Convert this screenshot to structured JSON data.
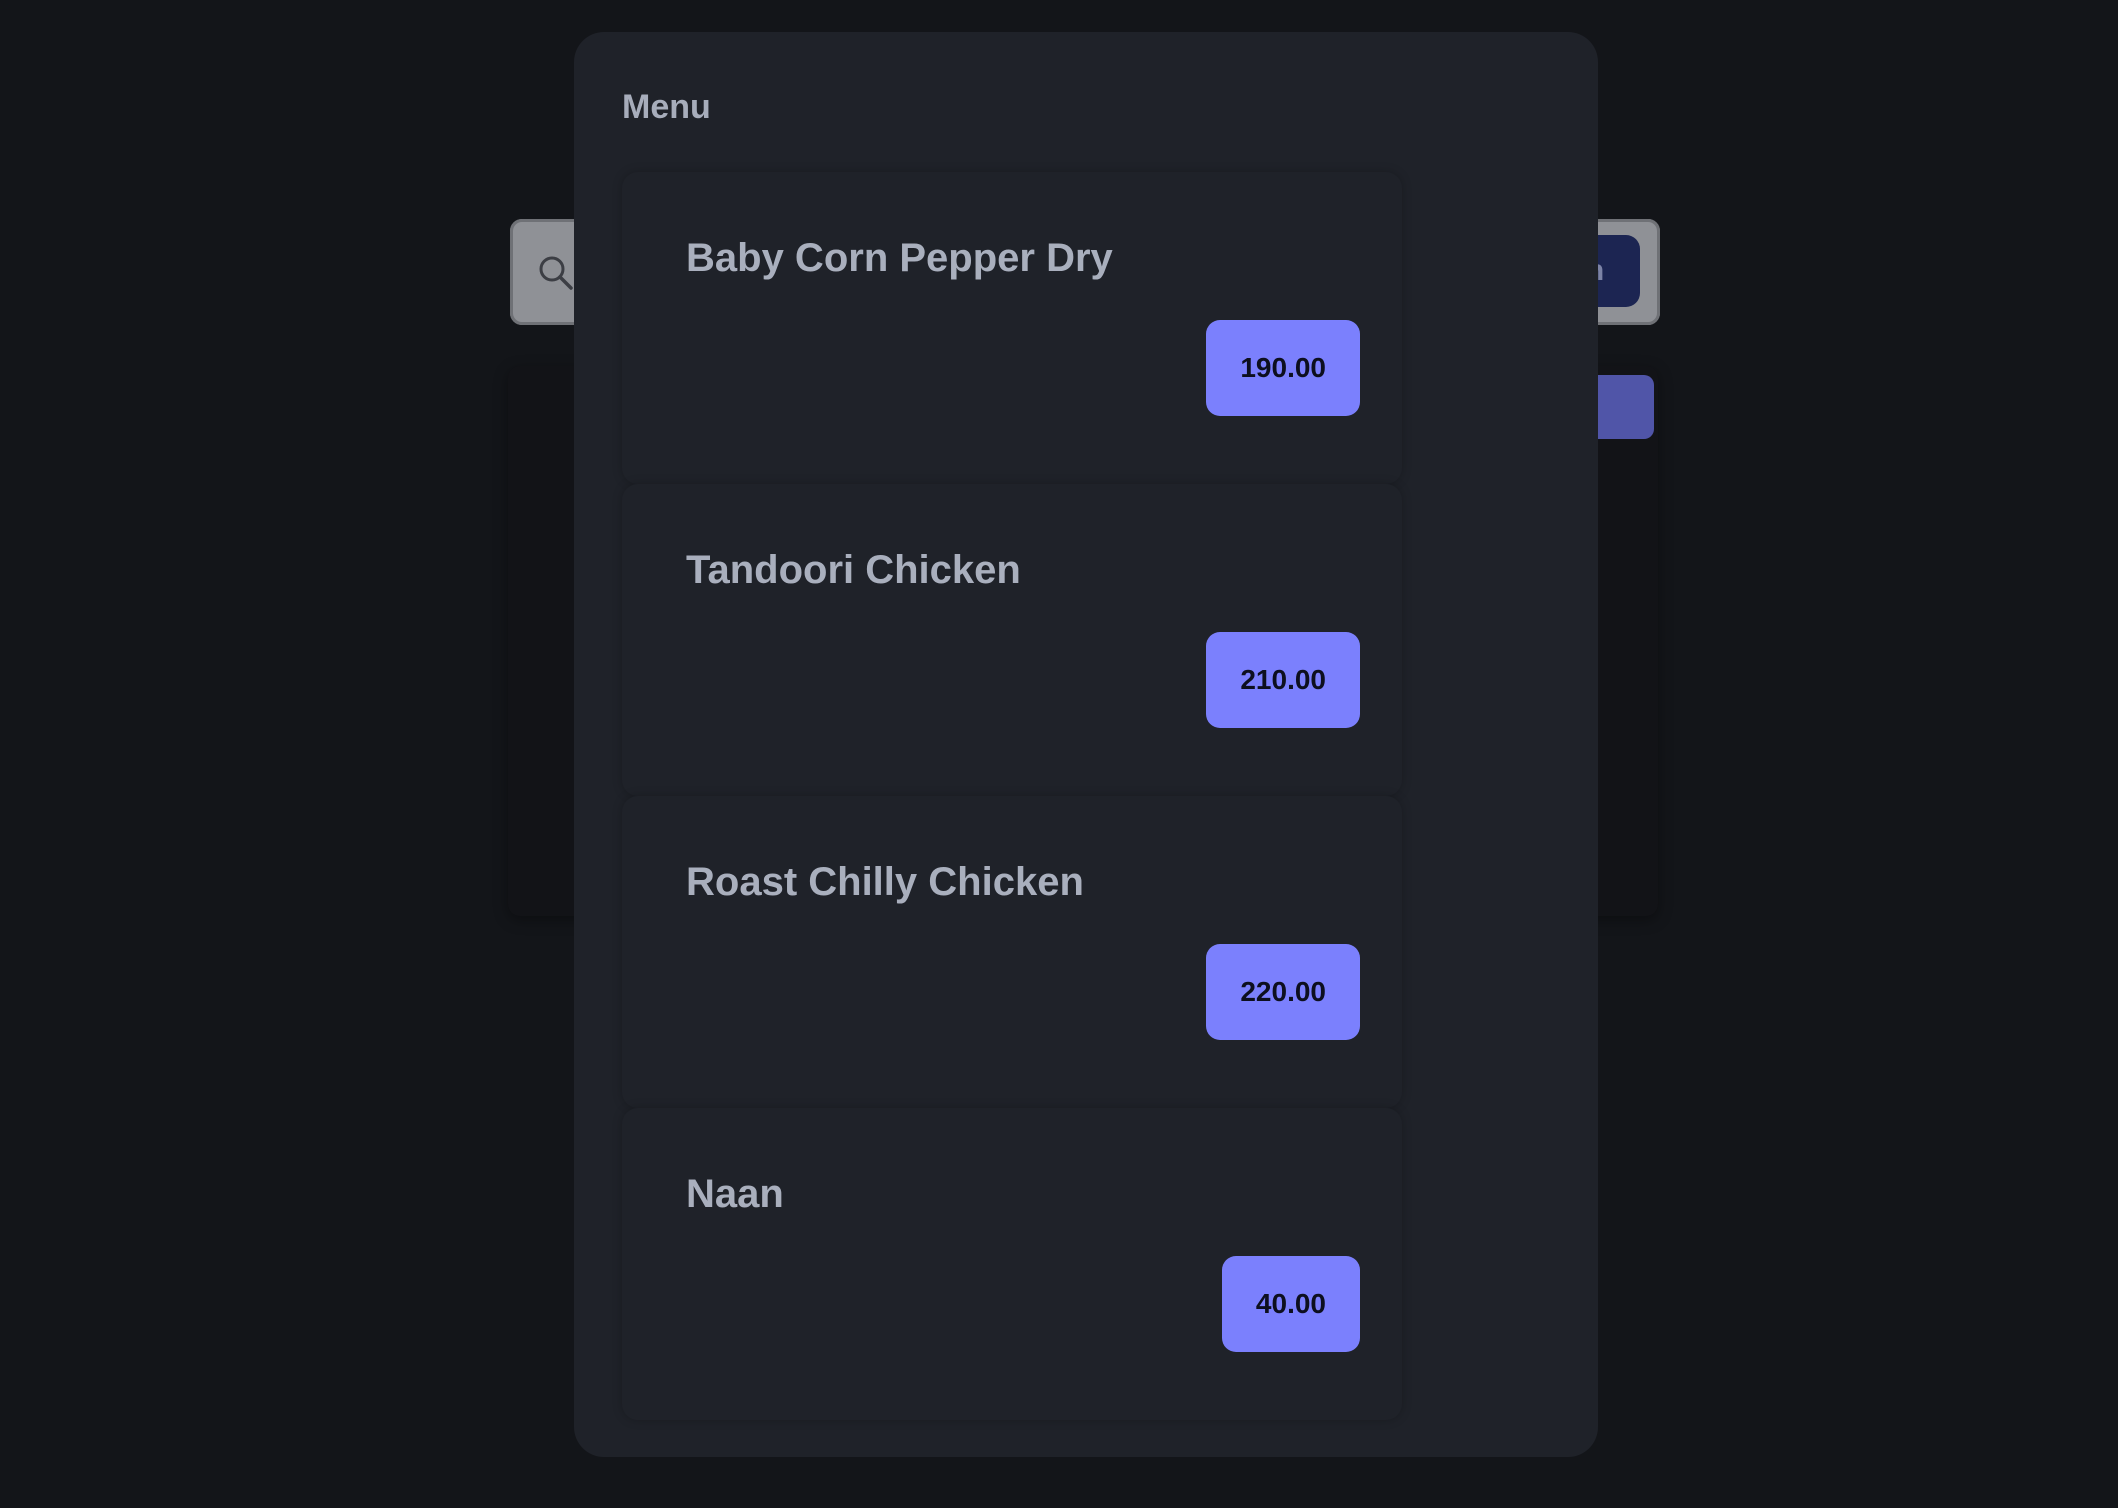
{
  "background": {
    "search_button_label": "h"
  },
  "modal": {
    "title": "Menu",
    "items": [
      {
        "name": "Baby Corn Pepper Dry",
        "price": "190.00"
      },
      {
        "name": "Tandoori Chicken",
        "price": "210.00"
      },
      {
        "name": "Roast Chilly Chicken",
        "price": "220.00"
      },
      {
        "name": "Naan",
        "price": "40.00"
      }
    ]
  },
  "colors": {
    "page_background": "#131519",
    "modal_background": "#1f2229",
    "price_button": "#7b80fd",
    "text_primary": "#a9afbd"
  }
}
